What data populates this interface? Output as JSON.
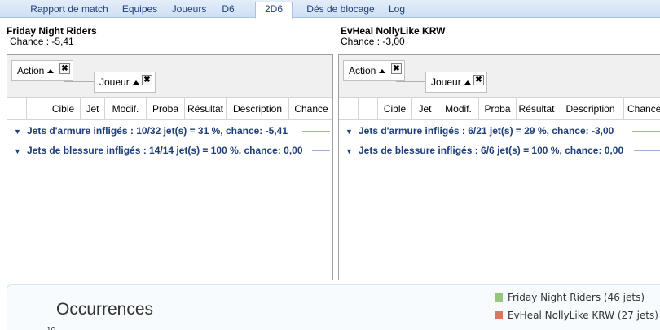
{
  "tabs": [
    {
      "label": "Rapport de match",
      "active": false
    },
    {
      "label": "Equipes",
      "active": false
    },
    {
      "label": "Joueurs",
      "active": false
    },
    {
      "label": "D6",
      "active": false
    },
    {
      "label": "2D6",
      "active": true
    },
    {
      "label": "Dés de blocage",
      "active": false
    },
    {
      "label": "Log",
      "active": false
    }
  ],
  "teams": [
    {
      "name": "Friday Night Riders",
      "chance": "Chance : -5,41",
      "group_chips": [
        {
          "label": "Action"
        },
        {
          "label": "Joueur"
        }
      ],
      "columns": [
        "Cible",
        "Jet",
        "Modif.",
        "Proba",
        "Résultat",
        "Description",
        "Chance"
      ],
      "groups": [
        {
          "label": "Jets d'armure infligés :  10/32 jet(s) = 31 %, chance: -5,41"
        },
        {
          "label": "Jets de blessure infligés :  14/14 jet(s) = 100 %, chance: 0,00"
        }
      ]
    },
    {
      "name": "EvHeal NollyLike KRW",
      "chance": "Chance : -3,00",
      "group_chips": [
        {
          "label": "Action"
        },
        {
          "label": "Joueur"
        }
      ],
      "columns": [
        "Cible",
        "Jet",
        "Modif.",
        "Proba",
        "Résultat",
        "Description",
        "Chance"
      ],
      "groups": [
        {
          "label": "Jets d'armure infligés :  6/21 jet(s) = 29 %, chance: -3,00"
        },
        {
          "label": "Jets de blessure infligés :  6/6 jet(s) = 100 %, chance: 0,00"
        }
      ]
    }
  ],
  "chart": {
    "title": "Occurrences",
    "axis_top_tick": "10",
    "legend": [
      {
        "label": "Friday Night Riders (46 jets)",
        "color": "#97c47e"
      },
      {
        "label": "EvHeal NollyLike KRW (27 jets)",
        "color": "#e0735b"
      }
    ]
  }
}
